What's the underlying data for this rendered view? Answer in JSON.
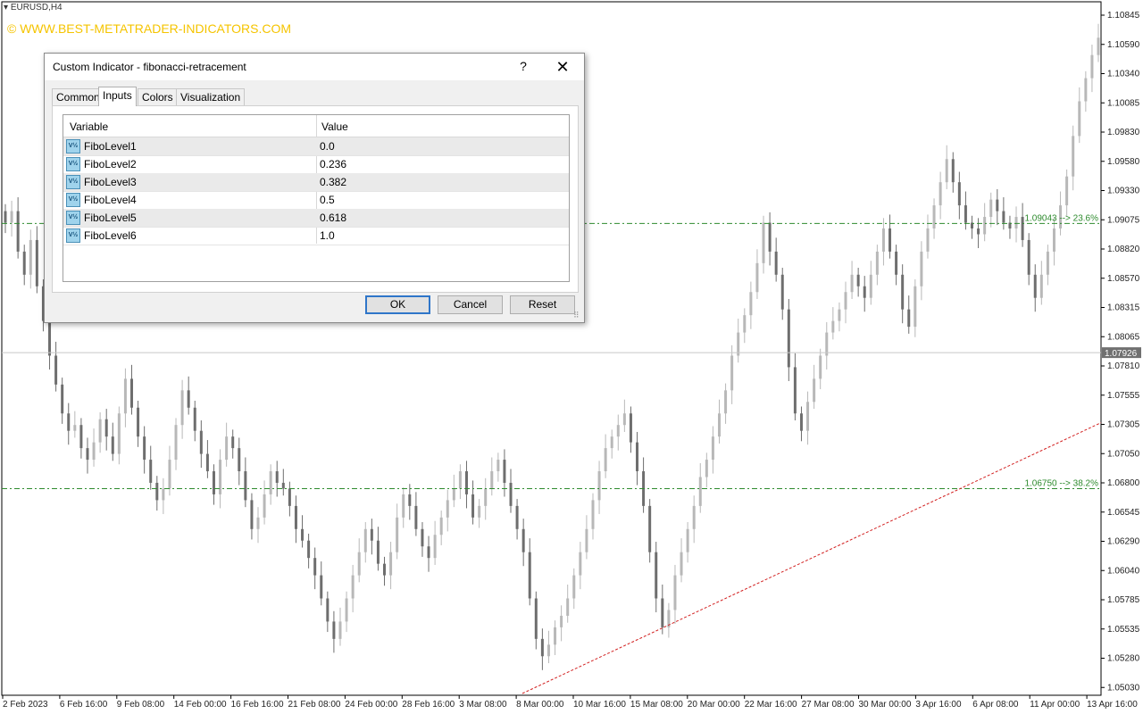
{
  "chart": {
    "symbol": "EURUSD,H4",
    "watermark": "© WWW.BEST-METATRADER-INDICATORS.COM",
    "price_labels": [
      "1.10845",
      "1.10590",
      "1.10340",
      "1.10085",
      "1.09830",
      "1.09580",
      "1.09330",
      "1.09075",
      "1.08820",
      "1.08570",
      "1.08315",
      "1.08065",
      "1.07810",
      "1.07555",
      "1.07305",
      "1.07050",
      "1.06800",
      "1.06545",
      "1.06290",
      "1.06040",
      "1.05785",
      "1.05535",
      "1.05280",
      "1.05030"
    ],
    "current_price": "1.07926",
    "time_labels": [
      "2 Feb 2023",
      "6 Feb 16:00",
      "9 Feb 08:00",
      "14 Feb 00:00",
      "16 Feb 16:00",
      "21 Feb 08:00",
      "24 Feb 00:00",
      "28 Feb 16:00",
      "3 Mar 08:00",
      "8 Mar 00:00",
      "10 Mar 16:00",
      "15 Mar 08:00",
      "20 Mar 00:00",
      "22 Mar 16:00",
      "27 Mar 08:00",
      "30 Mar 00:00",
      "3 Apr 16:00",
      "6 Apr 08:00",
      "11 Apr 00:00",
      "13 Apr 16:00"
    ],
    "fibo_labels": [
      "1.09043 --> 23.6%",
      "1.06750 --> 38.2%"
    ],
    "fibo_color": "#2e8b2e",
    "trend_color": "#d22020",
    "candle_up_color": "#b8b8b8",
    "candle_down_color": "#6e6e6e",
    "close_series": [
      1.0905,
      1.0915,
      1.088,
      1.086,
      1.089,
      1.085,
      1.082,
      1.079,
      1.0765,
      1.074,
      1.0725,
      1.073,
      1.071,
      1.07,
      1.0715,
      1.0735,
      1.072,
      1.0705,
      1.074,
      1.077,
      1.0745,
      1.072,
      1.07,
      1.068,
      1.0665,
      1.0675,
      1.07,
      1.073,
      1.076,
      1.0745,
      1.0725,
      1.0705,
      1.069,
      1.067,
      1.07,
      1.072,
      1.071,
      1.069,
      1.0665,
      1.064,
      1.065,
      1.067,
      1.069,
      1.068,
      1.0675,
      1.066,
      1.064,
      1.063,
      1.0615,
      1.06,
      1.058,
      1.056,
      1.0545,
      1.056,
      1.058,
      1.06,
      1.062,
      1.064,
      1.063,
      1.061,
      1.06,
      1.062,
      1.065,
      1.067,
      1.066,
      1.064,
      1.0625,
      1.0615,
      1.0635,
      1.065,
      1.0665,
      1.0675,
      1.069,
      1.067,
      1.065,
      1.066,
      1.0675,
      1.069,
      1.07,
      1.068,
      1.066,
      1.064,
      1.062,
      1.058,
      1.0545,
      1.053,
      1.054,
      1.0555,
      1.0565,
      1.058,
      1.06,
      1.062,
      1.064,
      1.0665,
      1.069,
      1.071,
      1.072,
      1.073,
      1.074,
      1.0715,
      1.069,
      1.066,
      1.062,
      1.058,
      1.0555,
      1.057,
      1.06,
      1.062,
      1.064,
      1.066,
      1.0685,
      1.07,
      1.072,
      1.074,
      1.076,
      1.079,
      1.081,
      1.0825,
      1.0845,
      1.087,
      1.0905,
      1.088,
      1.086,
      1.083,
      1.078,
      1.074,
      1.0725,
      1.075,
      1.077,
      1.079,
      1.081,
      1.082,
      1.083,
      1.0845,
      1.086,
      1.085,
      1.084,
      1.086,
      1.088,
      1.09,
      1.088,
      1.086,
      1.083,
      1.0815,
      1.085,
      1.088,
      1.09,
      1.092,
      1.094,
      1.096,
      1.094,
      1.092,
      1.0905,
      1.09,
      1.0895,
      1.091,
      1.0925,
      1.0915,
      1.0905,
      1.09,
      1.091,
      1.089,
      1.086,
      1.084,
      1.086,
      1.088,
      1.09,
      1.092,
      1.0945,
      1.098,
      1.101,
      1.103,
      1.105,
      1.1065
    ]
  },
  "dialog": {
    "title": "Custom Indicator - fibonacci-retracement",
    "help": "?",
    "close": "✕",
    "tabs": [
      "Common",
      "Inputs",
      "Colors",
      "Visualization"
    ],
    "active_tab": "Inputs",
    "grid": {
      "col_variable": "Variable",
      "col_value": "Value",
      "icon_text": "V½",
      "rows": [
        {
          "variable": "FiboLevel1",
          "value": "0.0"
        },
        {
          "variable": "FiboLevel2",
          "value": "0.236"
        },
        {
          "variable": "FiboLevel3",
          "value": "0.382"
        },
        {
          "variable": "FiboLevel4",
          "value": "0.5"
        },
        {
          "variable": "FiboLevel5",
          "value": "0.618"
        },
        {
          "variable": "FiboLevel6",
          "value": "1.0"
        }
      ]
    },
    "buttons": {
      "ok": "OK",
      "cancel": "Cancel",
      "reset": "Reset"
    }
  }
}
